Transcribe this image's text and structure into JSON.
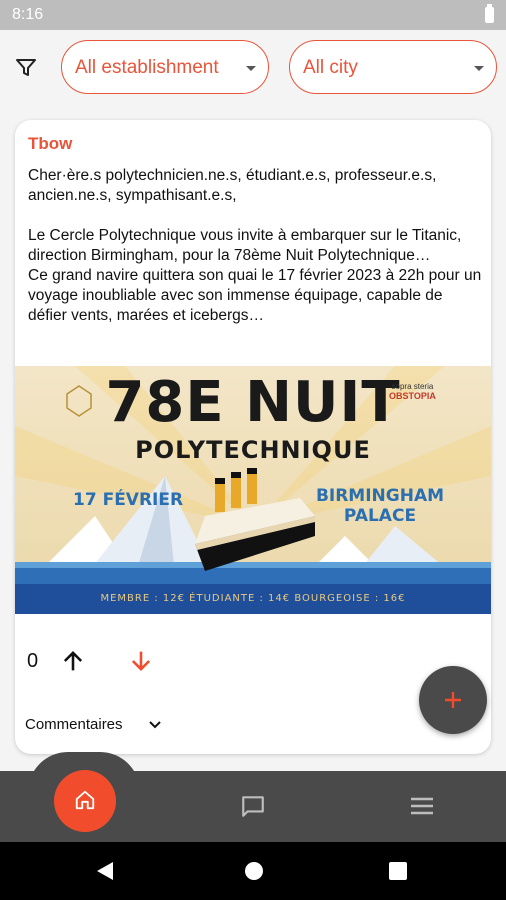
{
  "status_bar": {
    "time": "8:16",
    "battery_icon": "battery-full-icon"
  },
  "filters": {
    "filter_icon": "filter-icon",
    "establishment": {
      "value": "All establishment"
    },
    "city": {
      "value": "All city"
    }
  },
  "post": {
    "author": "Tbow",
    "paragraphs": [
      "Cher·ère.s polytechnicien.ne.s, étudiant.e.s, professeur.e.s, ancien.ne.s, sympathisant.e.s,",
      "",
      "Le Cercle Polytechnique vous invite à embarquer sur le Titanic, direction Birmingham, pour la 78ème Nuit Polytechnique…",
      "Ce grand navire quittera son quai le 17 février 2023 à 22h pour un voyage inoubliable avec son immense équipage, capable de défier vents, marées et icebergs…"
    ],
    "poster": {
      "title_line1": "78E NUIT",
      "title_line2": "POLYTECHNIQUE",
      "date": "17 FÉVRIER",
      "place_line1": "BIRMINGHAM",
      "place_line2": "PALACE",
      "brand_line1": "sopra steria",
      "brand_line2": "OBSTOPIA",
      "prices": "MEMBRE : 12€   ÉTUDIANTE : 14€   BOURGEOISE : 16€"
    },
    "score": "0",
    "upvote_icon": "arrow-up-icon",
    "downvote_icon": "arrow-down-icon",
    "comments_label": "Commentaires",
    "colors": {
      "accent": "#e8553a",
      "downvote": "#f14d2d"
    }
  },
  "fab": {
    "icon": "plus-icon"
  },
  "bottom_nav": {
    "items": [
      {
        "icon": "home-icon",
        "active": true
      },
      {
        "icon": "chat-icon",
        "active": false
      },
      {
        "icon": "menu-icon",
        "active": false
      }
    ],
    "active_color": "#f14d2d"
  }
}
